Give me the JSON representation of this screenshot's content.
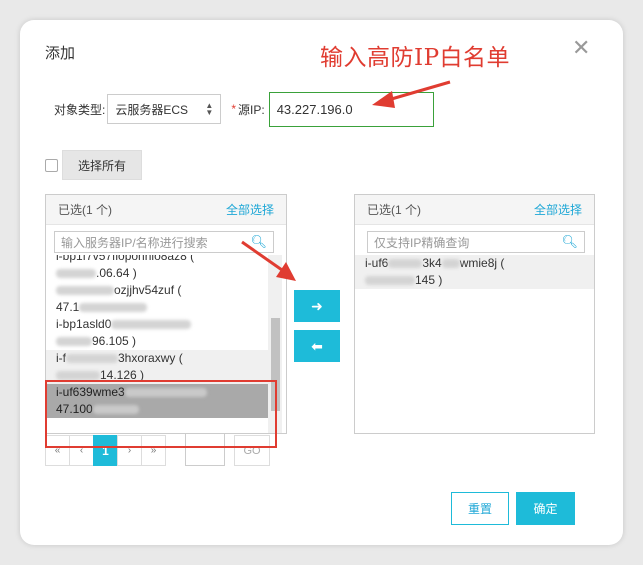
{
  "dialog": {
    "title": "添加",
    "annotation": "输入高防IP白名单"
  },
  "form": {
    "object_type_label": "对象类型:",
    "object_type_value": "云服务器ECS",
    "source_ip_required_mark": "*",
    "source_ip_label": "源IP:",
    "source_ip_value": "43.227.196.0",
    "select_all_label": "选择所有"
  },
  "left_panel": {
    "count": "已选(1 个)",
    "select_all_link": "全部选择",
    "search_placeholder": "输入服务器IP/名称进行搜索",
    "items": [
      {
        "line1": "i-bp1f7v57floponnlo8az8 (",
        "line2": ".06.64 )"
      },
      {
        "line1": "ozjjhv54zuf (",
        "line2": "47.1"
      },
      {
        "line1": "i-bp1asld0",
        "line2": "96.105 )"
      },
      {
        "line1": "i-f",
        "line1b": "3hxoraxwy (",
        "line2": "14.126 )"
      },
      {
        "line1": "i-uf639wme3",
        "line2": "47.100"
      }
    ]
  },
  "right_panel": {
    "count": "已选(1 个)",
    "select_all_link": "全部选择",
    "search_placeholder": "仅支持IP精确查询",
    "items": [
      {
        "line1": "i-uf6",
        "line1b": "3k4",
        "line1c": "wmie8j (",
        "line2": "145 )"
      }
    ]
  },
  "transfer": {
    "right_arrow": "➜",
    "left_arrow": "⬅"
  },
  "pagination": {
    "first": "«",
    "prev": "‹",
    "current": "1",
    "next": "›",
    "last": "»",
    "go": "GO"
  },
  "footer": {
    "reset": "重置",
    "confirm": "确定"
  },
  "icons": {
    "close": "close-icon",
    "search": "search-icon"
  },
  "colors": {
    "accent": "#1ebbd9",
    "annotation": "#e03c31",
    "ip_border": "#3aa13a"
  }
}
